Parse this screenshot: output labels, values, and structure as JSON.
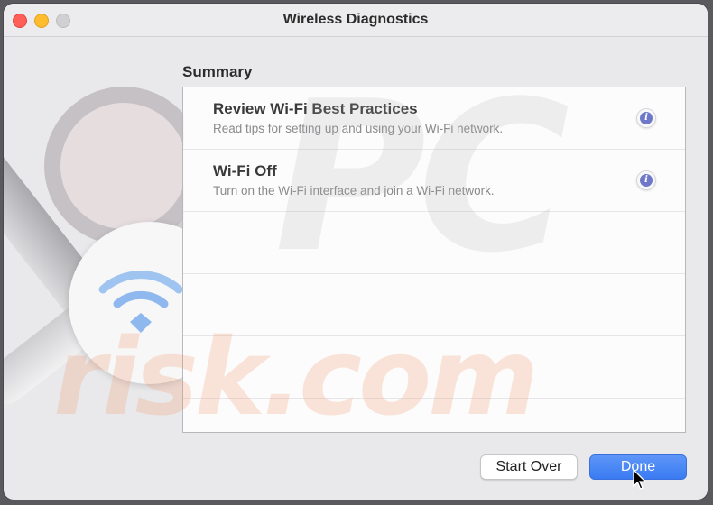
{
  "window": {
    "title": "Wireless Diagnostics"
  },
  "summary": {
    "heading": "Summary",
    "items": [
      {
        "title": "Review Wi-Fi Best Practices",
        "subtitle": "Read tips for setting up and using your Wi-Fi network.",
        "info_icon": "info-icon"
      },
      {
        "title": "Wi-Fi Off",
        "subtitle": "Turn on the Wi-Fi interface and join a Wi-Fi network.",
        "info_icon": "info-icon"
      }
    ]
  },
  "buttons": {
    "start_over": "Start Over",
    "done": "Done"
  },
  "colors": {
    "accent": "#3a7bf2",
    "close": "#ff5f57",
    "minimize": "#febc2e",
    "info": "#6e78c8"
  }
}
